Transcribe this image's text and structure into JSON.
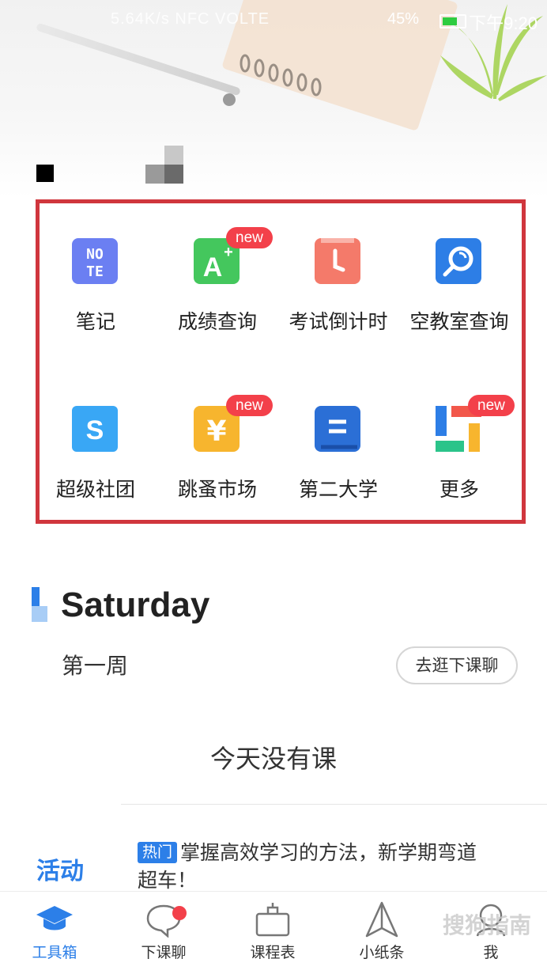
{
  "status_bar": {
    "left_text": "5.64K/s  NFC  VOLTE",
    "battery": "45%",
    "time": "下午9:20"
  },
  "tools": [
    {
      "label": "笔记",
      "icon": "note-icon",
      "color": "#6b7ff2",
      "badge": ""
    },
    {
      "label": "成绩查询",
      "icon": "grade-a-plus-icon",
      "color": "#44c75d",
      "badge": "new"
    },
    {
      "label": "考试倒计时",
      "icon": "clock-icon",
      "color": "#f47a6a",
      "badge": ""
    },
    {
      "label": "空教室查询",
      "icon": "magnifier-icon",
      "color": "#2d7ee6",
      "badge": ""
    },
    {
      "label": "超级社团",
      "icon": "club-s-icon",
      "color": "#39a7f5",
      "badge": ""
    },
    {
      "label": "跳蚤市场",
      "icon": "yen-icon",
      "color": "#f7b52e",
      "badge": "new"
    },
    {
      "label": "第二大学",
      "icon": "book-icon",
      "color": "#2b6fd6",
      "badge": ""
    },
    {
      "label": "更多",
      "icon": "more-grid-icon",
      "color": "#f2574a",
      "badge": "new"
    }
  ],
  "schedule": {
    "day": "Saturday",
    "week": "第一周",
    "chat_button": "去逛下课聊",
    "empty_text": "今天没有课"
  },
  "activity": {
    "label": "活动",
    "hot_tag": "热门",
    "text": "掌握高效学习的方法，新学期弯道超车！"
  },
  "tabbar": [
    {
      "label": "工具箱",
      "icon": "graduation-cap-icon",
      "active": true
    },
    {
      "label": "下课聊",
      "icon": "chat-bubble-icon",
      "active": false
    },
    {
      "label": "课程表",
      "icon": "schedule-bag-icon",
      "active": false
    },
    {
      "label": "小纸条",
      "icon": "paper-plane-icon",
      "active": false
    },
    {
      "label": "我",
      "icon": "profile-icon",
      "active": false
    }
  ],
  "watermark": "搜狗指南",
  "colors": {
    "accent": "#2c7fe8",
    "highlight_border": "#d0363d",
    "badge": "#f3404a"
  }
}
